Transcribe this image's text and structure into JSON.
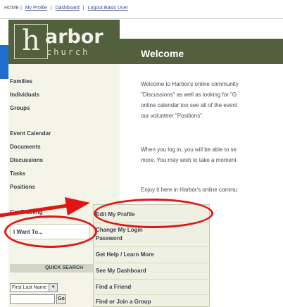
{
  "topnav": {
    "home": "HOME |",
    "my_profile": "My Profile",
    "sep1": "|",
    "dashboard": "Dashboard",
    "sep2": "|",
    "logout": "Logout Basic User"
  },
  "logo": {
    "h": "h",
    "arbor": "arbor",
    "church": "church"
  },
  "sidebar": {
    "groups1": [
      "Families",
      "Individuals",
      "Groups"
    ],
    "groups2": [
      "Event Calendar",
      "Documents",
      "Discussions",
      "Tasks",
      "Positions"
    ],
    "get_training": "Get Training",
    "i_want_to": "I Want To...",
    "quick_search": {
      "header": "QUICK SEARCH",
      "select_value": "First Last Name",
      "input_value": "",
      "go_label": "Go"
    }
  },
  "main": {
    "title": "Welcome",
    "paragraphs": [
      [
        "Welcome to Harbor's online community",
        "\"Discussions\" as well as looking for \"G",
        "online calendar too see all of the event",
        "our volunteer \"Positions\"."
      ],
      [
        "When you log in, you will be able to se",
        "more. You may wish to take a moment"
      ],
      [
        "Enjoy it here in Harbor's online commu"
      ]
    ]
  },
  "dropdown": {
    "items": [
      "Edit My Profile",
      "Change My Login",
      "Password",
      "Get Help / Learn More",
      "See My Dashboard",
      "Find a Friend",
      "Find or Join a Group"
    ]
  },
  "colors": {
    "brand_green": "#52603e",
    "annotation_red": "#e01515",
    "marker_blue": "#1f6fd0"
  }
}
